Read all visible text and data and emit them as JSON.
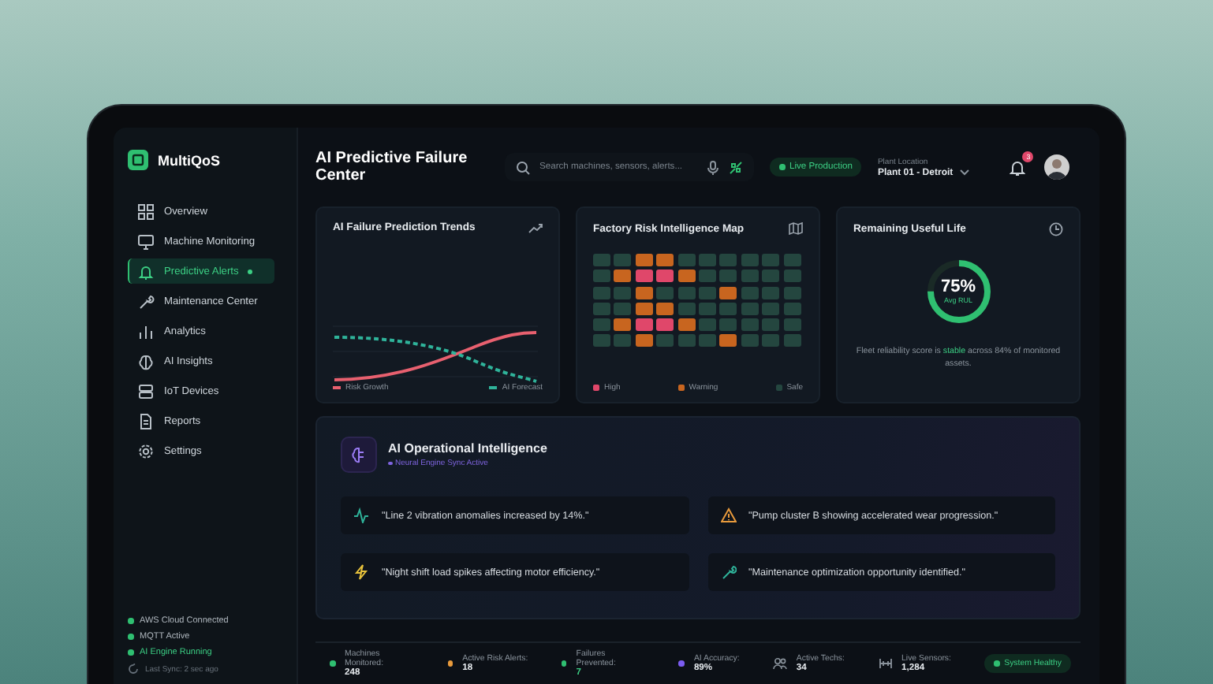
{
  "brand": {
    "name": "MultiQoS"
  },
  "sidebar": {
    "items": [
      {
        "label": "Overview",
        "selected": false,
        "badge": false
      },
      {
        "label": "Machine Monitoring",
        "selected": false,
        "badge": false
      },
      {
        "label": "Predictive Alerts",
        "selected": true,
        "badge": true
      },
      {
        "label": "Maintenance Center",
        "selected": false,
        "badge": false
      },
      {
        "label": "Analytics",
        "selected": false,
        "badge": false
      },
      {
        "label": "AI Insights",
        "selected": false,
        "badge": false
      },
      {
        "label": "IoT Devices",
        "selected": false,
        "badge": false
      },
      {
        "label": "Reports",
        "selected": false,
        "badge": false
      },
      {
        "label": "Settings",
        "selected": false,
        "badge": false
      }
    ],
    "statuses": [
      {
        "label": "AWS Cloud Connected",
        "color": "#2fbf71"
      },
      {
        "label": "MQTT Active",
        "color": "#2fbf71"
      },
      {
        "label": "AI Engine Running",
        "color": "#2fbf71"
      }
    ],
    "last_sync": "Last Sync: 2 sec ago"
  },
  "header": {
    "title": "AI Predictive Failure Center",
    "search": {
      "placeholder": "Search machines, sensors, alerts..."
    },
    "live_badge": "Live Production",
    "location_label": "Plant Location",
    "location_value": "Plant 01 - Detroit",
    "notification_count": "3"
  },
  "cards": [
    {
      "kind": "trend",
      "title": "AI Failure Prediction Trends",
      "legend": [
        {
          "label": "Risk Growth",
          "color": "#e8606f"
        },
        {
          "label": "AI Forecast",
          "color": "#2fb39a"
        }
      ]
    },
    {
      "kind": "heatmap",
      "title": "Factory Risk Intelligence Map",
      "rows": [
        [
          {
            "color": "#24463f"
          },
          {
            "color": "#24463f"
          },
          {
            "color": "#c8651f"
          },
          {
            "color": "#c8651f"
          },
          {
            "color": "#24463f"
          },
          {
            "color": "#24463f"
          },
          {
            "color": "#24463f"
          },
          {
            "color": "#24463f"
          },
          {
            "color": "#24463f"
          },
          {
            "color": "#24463f"
          }
        ],
        [
          {
            "color": "#24463f"
          },
          {
            "color": "#c8651f"
          },
          {
            "color": "#e0476a"
          },
          {
            "color": "#e0476a"
          },
          {
            "color": "#c8651f"
          },
          {
            "color": "#24463f"
          },
          {
            "color": "#24463f"
          },
          {
            "color": "#24463f"
          },
          {
            "color": "#24463f"
          },
          {
            "color": "#24463f"
          }
        ],
        [
          {
            "color": "#24463f"
          },
          {
            "color": "#24463f"
          },
          {
            "color": "#c8651f"
          },
          {
            "color": "#24463f"
          },
          {
            "color": "#24463f"
          },
          {
            "color": "#24463f"
          },
          {
            "color": "#c8651f"
          },
          {
            "color": "#24463f"
          },
          {
            "color": "#24463f"
          },
          {
            "color": "#24463f"
          }
        ],
        [
          {
            "color": "#24463f"
          },
          {
            "color": "#24463f"
          },
          {
            "color": "#c8651f"
          },
          {
            "color": "#c8651f"
          },
          {
            "color": "#24463f"
          },
          {
            "color": "#24463f"
          },
          {
            "color": "#24463f"
          },
          {
            "color": "#24463f"
          },
          {
            "color": "#24463f"
          },
          {
            "color": "#24463f"
          }
        ],
        [
          {
            "color": "#24463f"
          },
          {
            "color": "#c8651f"
          },
          {
            "color": "#e0476a"
          },
          {
            "color": "#e0476a"
          },
          {
            "color": "#c8651f"
          },
          {
            "color": "#24463f"
          },
          {
            "color": "#24463f"
          },
          {
            "color": "#24463f"
          },
          {
            "color": "#24463f"
          },
          {
            "color": "#24463f"
          }
        ],
        [
          {
            "color": "#24463f"
          },
          {
            "color": "#24463f"
          },
          {
            "color": "#c8651f"
          },
          {
            "color": "#24463f"
          },
          {
            "color": "#24463f"
          },
          {
            "color": "#24463f"
          },
          {
            "color": "#c8651f"
          },
          {
            "color": "#24463f"
          },
          {
            "color": "#24463f"
          },
          {
            "color": "#24463f"
          }
        ]
      ],
      "legend": [
        {
          "label": "High",
          "color": "#e0476a"
        },
        {
          "label": "Warning",
          "color": "#c8651f"
        },
        {
          "label": "Safe",
          "color": "#24463f"
        }
      ]
    },
    {
      "kind": "gauge",
      "title": "Remaining Useful Life",
      "level": 0.75,
      "value": "75%",
      "caption": "Avg RUL",
      "note": "Fleet reliability score is **stable** across 84% of monitored assets."
    }
  ],
  "intelligence": {
    "title": "AI Operational Intelligence",
    "status": "Neural Engine Sync Active",
    "insights": [
      {
        "text": "\"Line 2 vibration anomalies increased by 14%.\""
      },
      {
        "text": "\"Pump cluster B showing accelerated wear progression.\""
      },
      {
        "text": "\"Night shift load spikes affecting motor efficiency.\""
      },
      {
        "text": "\"Maintenance optimization opportunity identified.\""
      }
    ]
  },
  "stats": [
    {
      "kind": "dot",
      "color": "#2fbf71",
      "label": "Machines Monitored:",
      "value": "248"
    },
    {
      "kind": "dot",
      "color": "#e89a3c",
      "label": "Active Risk Alerts:",
      "value": "18"
    },
    {
      "kind": "dot",
      "color": "#2fbf71",
      "label": "Failures Prevented:",
      "value": "7"
    },
    {
      "kind": "dot",
      "color": "#7b5cf0",
      "label": "AI Accuracy:",
      "value": "89%"
    },
    {
      "kind": "people",
      "label": "Active Techs:",
      "value": "34"
    },
    {
      "kind": "sensor",
      "label": "Live Sensors:",
      "value": "1,284"
    }
  ],
  "system_badge": "System Healthy"
}
